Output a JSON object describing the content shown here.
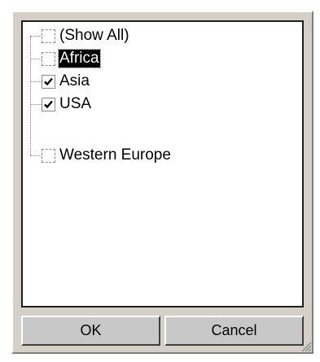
{
  "filter_list": {
    "items": [
      {
        "label": "(Show All)",
        "checked": false,
        "selected": false
      },
      {
        "label": "Africa",
        "checked": false,
        "selected": true
      },
      {
        "label": "Asia",
        "checked": true,
        "selected": false
      },
      {
        "label": "USA",
        "checked": true,
        "selected": false
      },
      {
        "label": "Western Europe",
        "checked": false,
        "selected": false
      }
    ]
  },
  "buttons": {
    "ok_label": "OK",
    "cancel_label": "Cancel"
  },
  "icons": {
    "checkmark": "checkmark-icon",
    "resize": "resize-grip-icon"
  }
}
